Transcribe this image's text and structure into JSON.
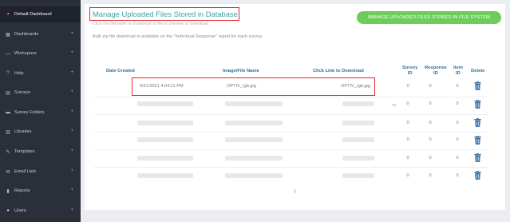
{
  "sidebar": {
    "items": [
      {
        "label": "Default Dashboard",
        "icon": "dashboard-icon",
        "glyph": "◕",
        "plus": ""
      },
      {
        "label": "Dashboards",
        "icon": "dashboards-icon",
        "glyph": "▦",
        "plus": "+"
      },
      {
        "label": "Workspace",
        "icon": "workspace-icon",
        "glyph": "▭",
        "plus": "+"
      },
      {
        "label": "Help",
        "icon": "help-icon",
        "glyph": "?",
        "plus": "+"
      },
      {
        "label": "Surveys",
        "icon": "surveys-icon",
        "glyph": "▤",
        "plus": "+"
      },
      {
        "label": "Survey Folders",
        "icon": "survey-folders-icon",
        "glyph": "▬",
        "plus": "+"
      },
      {
        "label": "Libraries",
        "icon": "libraries-icon",
        "glyph": "▥",
        "plus": "+"
      },
      {
        "label": "Templates",
        "icon": "templates-icon",
        "glyph": "✎",
        "plus": "+"
      },
      {
        "label": "Email Lists",
        "icon": "email-lists-icon",
        "glyph": "✉",
        "plus": "+"
      },
      {
        "label": "Reports",
        "icon": "reports-icon",
        "glyph": "▮",
        "plus": "+"
      },
      {
        "label": "Users",
        "icon": "users-icon",
        "glyph": "●",
        "plus": "+"
      }
    ]
  },
  "header": {
    "title": "Manage Uploaded Files Stored in Database",
    "subtitle": "Click the filename or thumbnail of file to preview or download.",
    "note": "Bulk zip file download is available on the \"Individual Response\" report for each survey.",
    "file_system_button": "MANAGE UPLOADED FILES STORED IN FILE SYSTEM"
  },
  "table": {
    "headers": {
      "date_created": "Date Created",
      "image_file_name": "Image/File Name",
      "download": "Click Link to Download",
      "survey_id": [
        "Survey",
        "ID"
      ],
      "response_id": [
        "Response",
        "ID"
      ],
      "item_id": [
        "Item",
        "ID"
      ],
      "delete": "Delete"
    },
    "rows": [
      {
        "date": "9/21/2021 4:04:11 PM",
        "file": "OPTIV_rgb.jpg",
        "link": "OPTIV_rgb.jpg",
        "survey_id": "0",
        "response_id": "0",
        "item_id": "0"
      },
      {
        "date": "",
        "file": "",
        "link": "",
        "survey_id": "0",
        "response_id": "0",
        "item_id": "0"
      },
      {
        "date": "",
        "file": "",
        "link": "",
        "survey_id": "0",
        "response_id": "0",
        "item_id": "0"
      },
      {
        "date": "",
        "file": "",
        "link": "",
        "survey_id": "0",
        "response_id": "0",
        "item_id": "0"
      },
      {
        "date": "",
        "file": "",
        "link": "",
        "survey_id": "0",
        "response_id": "0",
        "item_id": "0"
      },
      {
        "date": "",
        "file": "",
        "link": "",
        "survey_id": "0",
        "response_id": "0",
        "item_id": "0"
      }
    ],
    "stray_text": "cx",
    "page_number": "1"
  },
  "colors": {
    "sidebar_bg": "#2b2f3a",
    "title_accent": "#3aa6a2",
    "highlight_border": "#e8272a",
    "button_green": "#6ccd5b",
    "header_blue": "#2d6f9a",
    "trash_blue": "#2f6fa8"
  }
}
